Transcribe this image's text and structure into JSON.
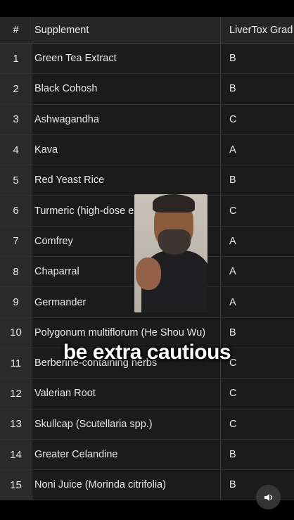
{
  "table": {
    "headers": {
      "num": "#",
      "supplement": "Supplement",
      "grade": "LiverTox Grad"
    },
    "rows": [
      {
        "num": "1",
        "supplement": "Green Tea Extract",
        "grade": "B"
      },
      {
        "num": "2",
        "supplement": "Black Cohosh",
        "grade": "B"
      },
      {
        "num": "3",
        "supplement": "Ashwagandha",
        "grade": "C"
      },
      {
        "num": "4",
        "supplement": "Kava",
        "grade": "A"
      },
      {
        "num": "5",
        "supplement": "Red Yeast Rice",
        "grade": "B"
      },
      {
        "num": "6",
        "supplement": "Turmeric (high-dose extra",
        "grade": "C"
      },
      {
        "num": "7",
        "supplement": "Comfrey",
        "grade": "A"
      },
      {
        "num": "8",
        "supplement": "Chaparral",
        "grade": "A"
      },
      {
        "num": "9",
        "supplement": "Germander",
        "grade": "A"
      },
      {
        "num": "10",
        "supplement": "Polygonum multiflorum (He Shou Wu)",
        "grade": "B"
      },
      {
        "num": "11",
        "supplement": "Berberine-containing herbs",
        "grade": "C"
      },
      {
        "num": "12",
        "supplement": "Valerian Root",
        "grade": "C"
      },
      {
        "num": "13",
        "supplement": "Skullcap (Scutellaria spp.)",
        "grade": "C"
      },
      {
        "num": "14",
        "supplement": "Greater Celandine",
        "grade": "B"
      },
      {
        "num": "15",
        "supplement": "Noni Juice (Morinda citrifolia)",
        "grade": "B"
      }
    ]
  },
  "caption": "be extra cautious",
  "sound_button_icon": "speaker-icon"
}
